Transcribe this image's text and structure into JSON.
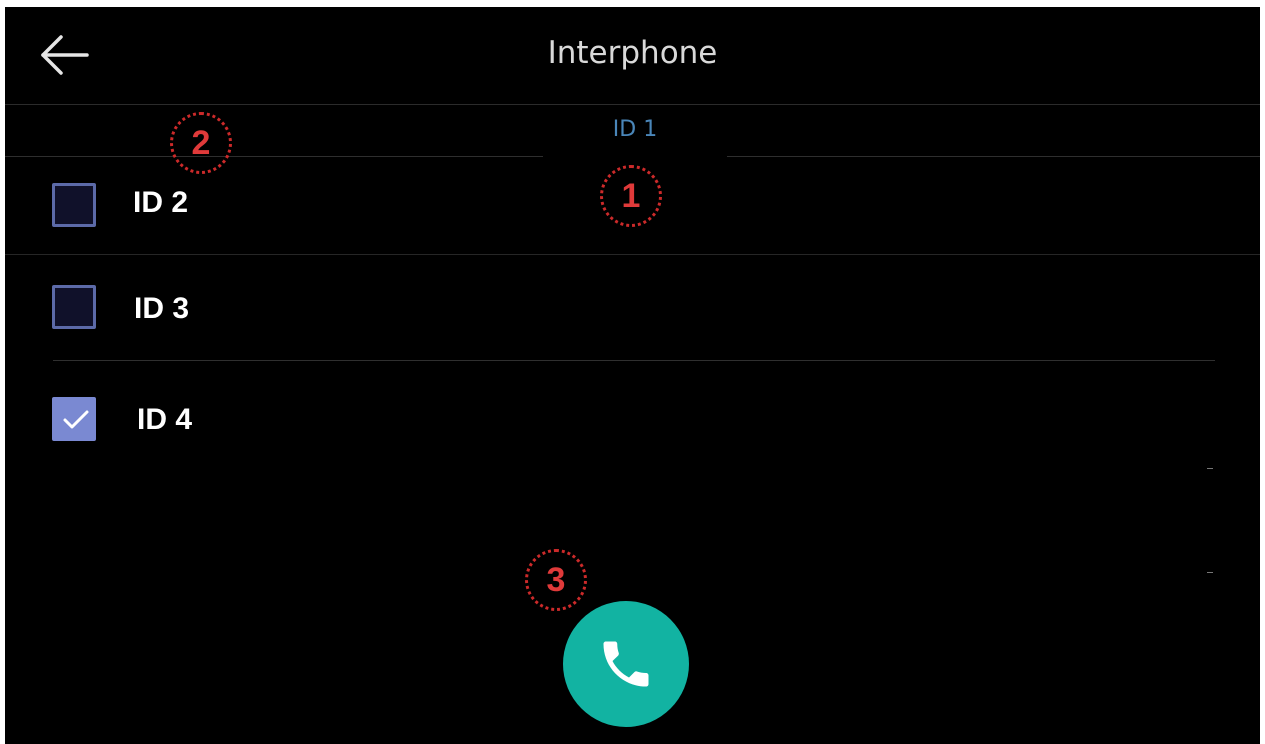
{
  "header": {
    "title": "Interphone",
    "back_icon": "back-arrow-icon"
  },
  "tabs": {
    "active_label": "ID 1",
    "active_color": "#4a86b9"
  },
  "devices": [
    {
      "label": "ID 2",
      "checked": false
    },
    {
      "label": "ID 3",
      "checked": false
    },
    {
      "label": "ID 4",
      "checked": true
    }
  ],
  "annotations": [
    "1",
    "2",
    "3"
  ],
  "call_button": {
    "icon": "phone-icon",
    "color": "#12b3a2"
  },
  "colors": {
    "background": "#000000",
    "checkbox_border": "#5c6aa8",
    "checkbox_checked": "#7a89d2",
    "annotation": "#e03a3a"
  }
}
